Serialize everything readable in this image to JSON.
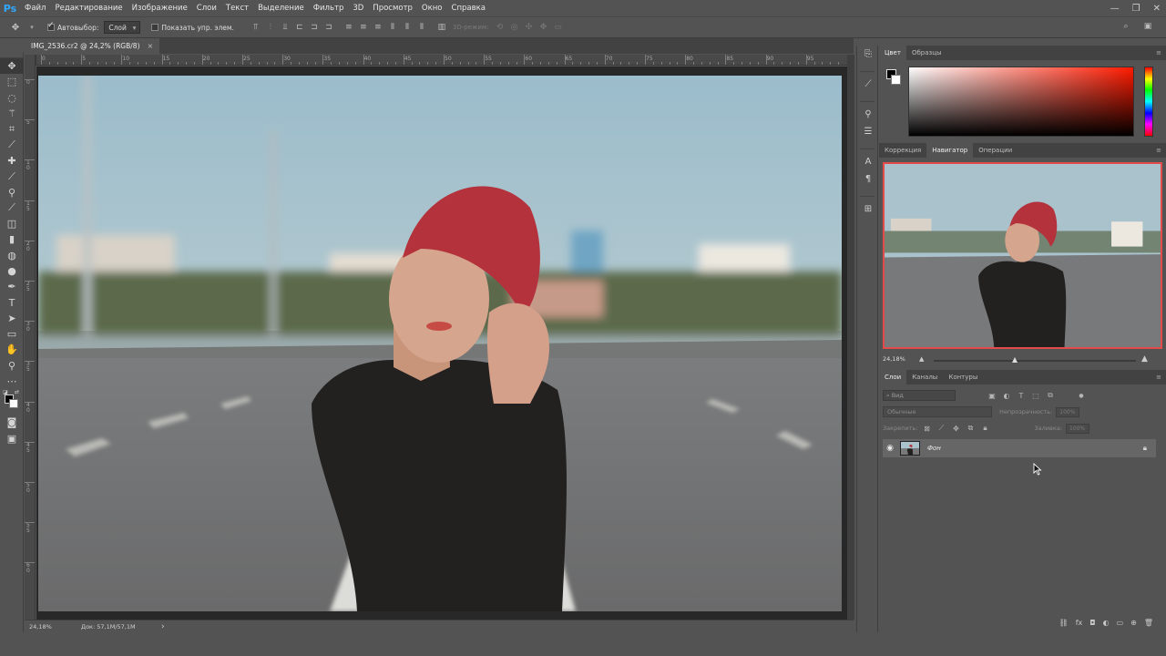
{
  "app": {
    "logo": "Ps",
    "menu": [
      "Файл",
      "Редактирование",
      "Изображение",
      "Слои",
      "Текст",
      "Выделение",
      "Фильтр",
      "3D",
      "Просмотр",
      "Окно",
      "Справка"
    ],
    "window_controls": {
      "minimize": "—",
      "restore": "❐",
      "close": "✕"
    }
  },
  "options_bar": {
    "autoselect_label": "Автовыбор:",
    "autoselect_checked": true,
    "autoselect_target": "Слой",
    "show_transform_label": "Показать упр. элем.",
    "show_transform_checked": false,
    "mode_3d_label": "3D-режим:"
  },
  "document": {
    "tab_title": "IMG_2536.cr2 @ 24,2% (RGB/8)",
    "tab_close": "×",
    "ruler_h_ticks": [
      "0",
      "5",
      "10",
      "15",
      "20",
      "25",
      "30",
      "35",
      "40",
      "45",
      "50",
      "55",
      "60",
      "65",
      "70",
      "75",
      "80",
      "85",
      "90",
      "95"
    ],
    "ruler_v_ticks": [
      "0",
      "5",
      "1 0",
      "1 5",
      "2 0",
      "2 5",
      "3 0",
      "3 5",
      "4 0",
      "4 5",
      "5 0",
      "5 5",
      "6 0"
    ]
  },
  "status": {
    "zoom": "24,18%",
    "doc_size": "Док: 57,1M/57,1M",
    "arrow": "›"
  },
  "color_panel": {
    "tabs": [
      "Цвет",
      "Образцы"
    ],
    "active_tab": "Цвет",
    "foreground": "#000000",
    "background": "#ffffff",
    "field_hue": "#ff1a00"
  },
  "navigator_panel": {
    "tabs": [
      "Коррекция",
      "Навигатор",
      "Операции"
    ],
    "active_tab": "Навигатор",
    "zoom": "24,18%",
    "view_frame_color": "#e34a4a",
    "zoom_slider_position": 0.4
  },
  "layers_panel": {
    "tabs": [
      "Слои",
      "Каналы",
      "Контуры"
    ],
    "active_tab": "Слои",
    "kind_placeholder": "Вид",
    "blend_mode": "Обычные",
    "opacity_label": "Непрозрачность:",
    "opacity_value": "100%",
    "lock_label": "Закрепить:",
    "fill_label": "Заливка:",
    "fill_value": "100%",
    "layers": [
      {
        "name": "Фон",
        "visible": true,
        "locked": true
      }
    ]
  }
}
